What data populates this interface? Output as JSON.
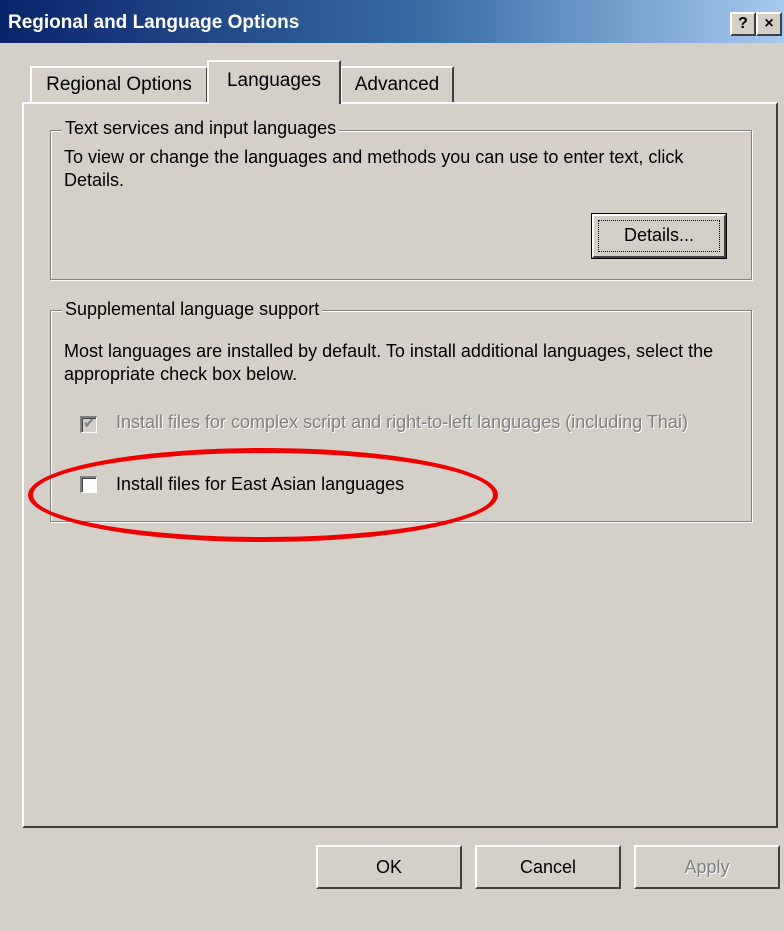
{
  "window": {
    "title": "Regional and Language Options",
    "help_label": "?",
    "close_label": "×"
  },
  "tabs": [
    {
      "label": "Regional Options",
      "active": false
    },
    {
      "label": "Languages",
      "active": true
    },
    {
      "label": "Advanced",
      "active": false
    }
  ],
  "text_services": {
    "group_title": "Text services and input languages",
    "description": "To view or change the languages and methods you can use to enter text, click Details.",
    "details_button": "Details..."
  },
  "supplemental": {
    "group_title": "Supplemental language support",
    "description": "Most languages are installed by default. To install additional languages, select the appropriate check box below.",
    "complex_script": {
      "label": "Install files for complex script and right-to-left languages (including Thai)",
      "checked": true,
      "enabled": false
    },
    "east_asian": {
      "label": "Install files for East Asian languages",
      "checked": false,
      "enabled": true
    }
  },
  "buttons": {
    "ok": "OK",
    "cancel": "Cancel",
    "apply": "Apply"
  },
  "colors": {
    "annotation": "#ee0000",
    "dialog_face": "#d4d0c8",
    "title_bar": "#0a246a"
  }
}
